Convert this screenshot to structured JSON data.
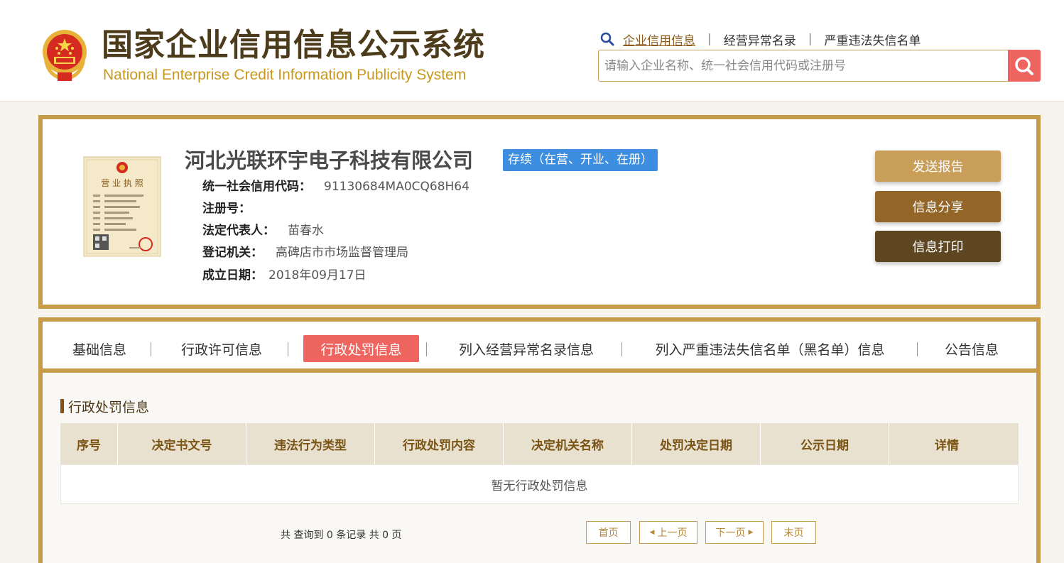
{
  "header": {
    "title_cn": "国家企业信用信息公示系统",
    "title_en": "National Enterprise Credit Information Publicity System",
    "nav": [
      "企业信用信息",
      "经营异常名录",
      "严重违法失信名单"
    ],
    "search_placeholder": "请输入企业名称、统一社会信用代码或注册号"
  },
  "company": {
    "name": "河北光联环宇电子科技有限公司",
    "status": "存续（在营、开业、在册）",
    "fields": [
      {
        "label": "统一社会信用代码：",
        "value": "91130684MA0CQ68H64"
      },
      {
        "label": "注册号：",
        "value": ""
      },
      {
        "label": "法定代表人：",
        "value": "苗春水"
      },
      {
        "label": "登记机关：",
        "value": "高碑店市市场监督管理局"
      },
      {
        "label": "成立日期：",
        "value": "2018年09月17日"
      }
    ],
    "license_title": "营 业 执 照",
    "buttons": {
      "send": "发送报告",
      "share": "信息分享",
      "print": "信息打印"
    }
  },
  "tabs": [
    "基础信息",
    "行政许可信息",
    "行政处罚信息",
    "列入经营异常名录信息",
    "列入严重违法失信名单（黑名单）信息",
    "公告信息"
  ],
  "active_tab": "行政处罚信息",
  "section": {
    "title": "行政处罚信息",
    "columns": [
      "序号",
      "决定书文号",
      "违法行为类型",
      "行政处罚内容",
      "决定机关名称",
      "处罚决定日期",
      "公示日期",
      "详情"
    ],
    "empty_text": "暂无行政处罚信息"
  },
  "pager": {
    "summary": "共 查询到 0 条记录 共 0 页",
    "first": "首页",
    "prev": "上一页",
    "next": "下一页",
    "last": "末页"
  },
  "colors": {
    "gold_border": "#c59d4a",
    "active_tab": "#ee6560",
    "status_blue": "#3d8ee0"
  }
}
